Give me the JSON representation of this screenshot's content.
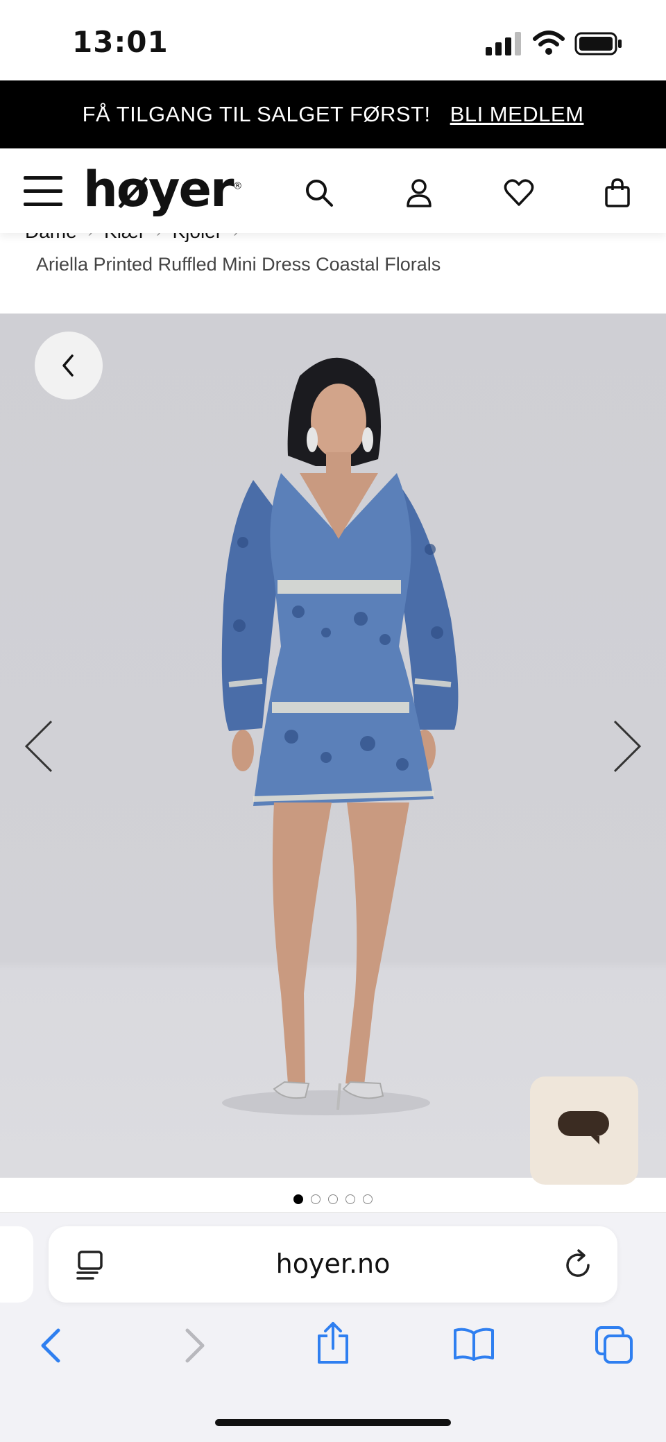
{
  "status": {
    "time": "13:01"
  },
  "promo": {
    "text": "FÅ TILGANG TIL SALGET FØRST!",
    "link": "BLI MEDLEM"
  },
  "header": {
    "logo": "høyer"
  },
  "breadcrumb": {
    "items": [
      "Dame",
      "Klær",
      "Kjoler"
    ]
  },
  "product": {
    "title": "Ariella Printed Ruffled Mini Dress Coastal Florals"
  },
  "gallery": {
    "total_images": 5,
    "active_index": 0
  },
  "browser": {
    "url": "hoyer.no"
  },
  "colors": {
    "accent_blue": "#2f7ff0",
    "chat_bg": "#efe6da",
    "chat_icon": "#3b2c22"
  }
}
